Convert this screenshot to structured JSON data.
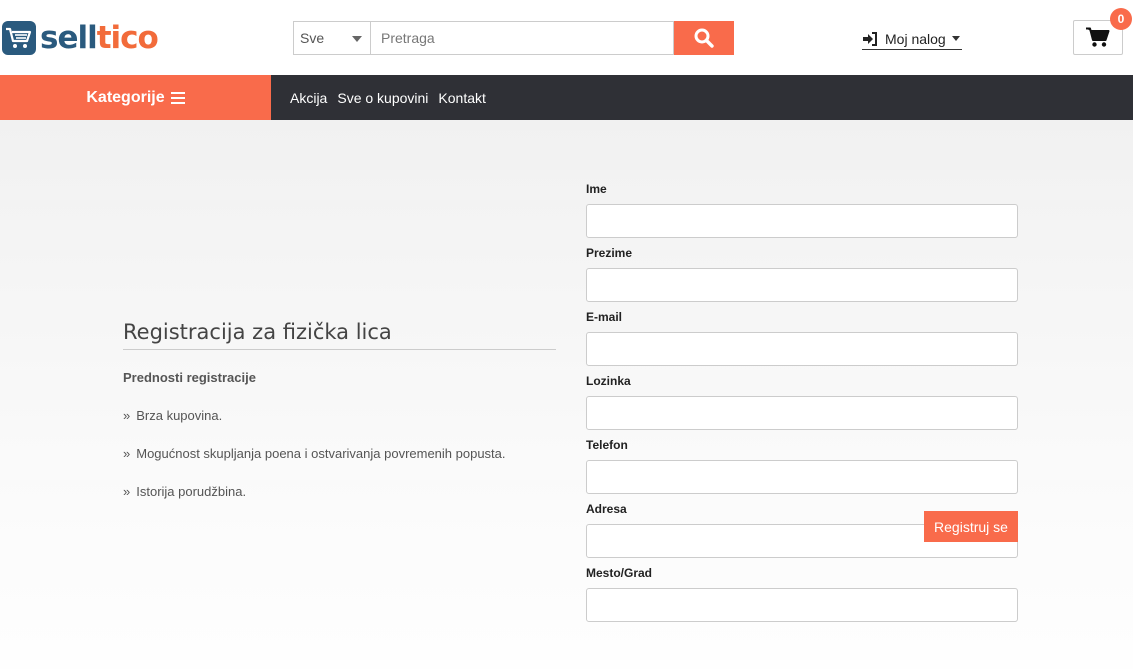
{
  "brand": {
    "logo_part1": "sell",
    "logo_part2": "tico",
    "primary_color": "#2a5a7e",
    "accent_color": "#f96b4b"
  },
  "search": {
    "category_selected": "Sve",
    "placeholder": "Pretraga",
    "button_icon": "search-icon"
  },
  "account": {
    "label": "Moj nalog",
    "icon": "sign-in-icon"
  },
  "cart": {
    "count": "0",
    "icon": "shopping-cart-icon"
  },
  "nav": {
    "categories_label": "Kategorije",
    "links": [
      "Akcija",
      "Sve o kupovini",
      "Kontakt"
    ]
  },
  "registration": {
    "title": "Registracija za fizička lica",
    "subtitle": "Prednosti registracije",
    "benefits": [
      "Brza kupovina.",
      "Mogućnost skupljanja poena i ostvarivanja povremenih popusta.",
      "Istorija porudžbina."
    ]
  },
  "form": {
    "fields": [
      {
        "label": "Ime",
        "value": ""
      },
      {
        "label": "Prezime",
        "value": ""
      },
      {
        "label": "E-mail",
        "value": ""
      },
      {
        "label": "Lozinka",
        "value": ""
      },
      {
        "label": "Telefon",
        "value": ""
      },
      {
        "label": "Adresa",
        "value": ""
      },
      {
        "label": "Mesto/Grad",
        "value": ""
      }
    ],
    "submit_label": "Registruj se"
  }
}
